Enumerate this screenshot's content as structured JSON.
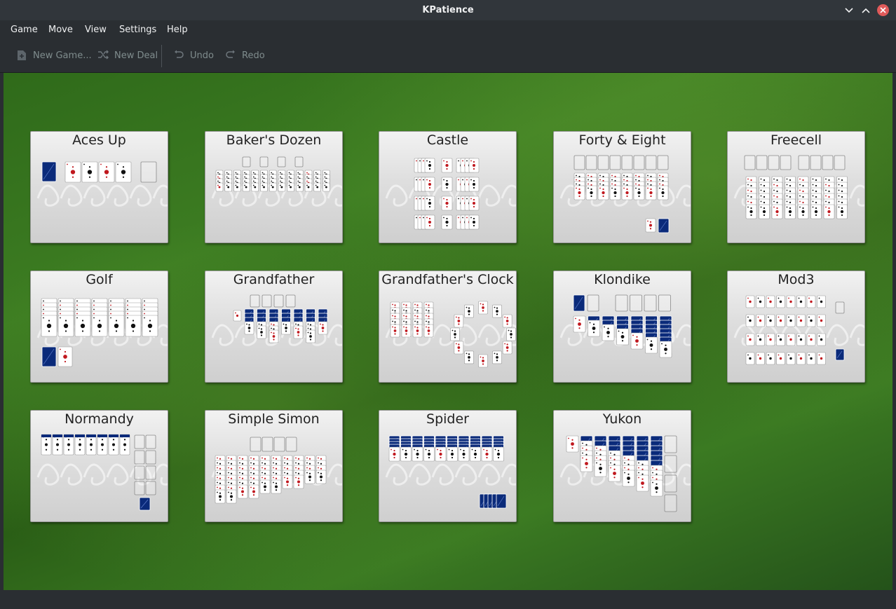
{
  "window": {
    "title": "KPatience",
    "minimize_icon": "chevron-down-icon",
    "maximize_icon": "chevron-up-icon",
    "close_icon": "close-icon"
  },
  "menu": {
    "items": [
      "Game",
      "Move",
      "View",
      "Settings",
      "Help"
    ]
  },
  "toolbar": {
    "new_game": "New Game...",
    "new_deal": "New Deal",
    "undo": "Undo",
    "redo": "Redo"
  },
  "colors": {
    "felt": "#3d7d22",
    "card_back": "#0a2a7a",
    "heart": "#c0181e",
    "spade": "#111111"
  },
  "games": [
    "Aces Up",
    "Baker's Dozen",
    "Castle",
    "Forty & Eight",
    "Freecell",
    "Golf",
    "Grandfather",
    "Grandfather's Clock",
    "Klondike",
    "Mod3",
    "Normandy",
    "Simple Simon",
    "Spider",
    "Yukon"
  ]
}
